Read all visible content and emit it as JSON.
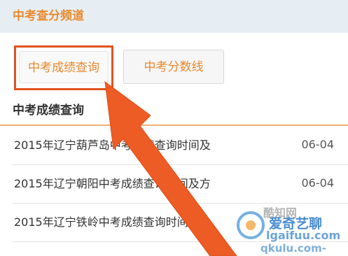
{
  "header": {
    "title": "中考查分频道"
  },
  "filters": {
    "scores_label": "中考成绩查询",
    "lines_label": "中考分数线"
  },
  "section": {
    "title": "中考成绩查询"
  },
  "news": [
    {
      "title": "2015年辽宁葫芦岛中考成绩查询时间及",
      "date": "06-04"
    },
    {
      "title": "2015年辽宁朝阳中考成绩查询时间及方",
      "date": "06-04"
    },
    {
      "title": "2015年辽宁铁岭中考成绩查询时间及",
      "date": ""
    }
  ],
  "watermark": {
    "site": "酷知网",
    "brand": "爱奇艺聊",
    "url": "lgaifuu.com",
    "url2": "qkulu.com-"
  },
  "colors": {
    "accent": "#e98b2f",
    "highlight": "#e0541c",
    "arrow": "#ec5c24",
    "header_bg": "#e7eef3"
  },
  "icons": [
    "annotation-arrow",
    "watermark-logo-icon"
  ]
}
